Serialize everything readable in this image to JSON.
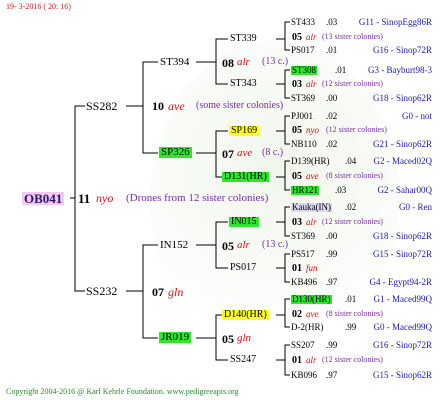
{
  "header": {
    "date": "19- 3-2016 ( 20: 16)"
  },
  "footer": {
    "copyright": "Copyright 2004-2016 @ Karl Kehrle Foundation.   www.pedigreeapis.org"
  },
  "root": {
    "id": "OB041",
    "year": "11",
    "race": "nyo",
    "note": "(Drones from 12 sister colonies)"
  },
  "gen1": [
    {
      "id": "SS282",
      "year": "10",
      "race": "ave",
      "note": "(some sister colonies)"
    },
    {
      "id": "SS232",
      "year": "07",
      "race": "gln",
      "note": ""
    }
  ],
  "gen2": [
    {
      "id": "ST394",
      "year": "08",
      "race": "alr",
      "note": "(13 c.)"
    },
    {
      "id": "SP326",
      "year": "07",
      "race": "ave",
      "note": "(8 c.)"
    },
    {
      "id": "IN152",
      "year": "05",
      "race": "alr",
      "note": "(13 c.)"
    },
    {
      "id": "JR019",
      "year": "05",
      "race": "gln",
      "note": ""
    }
  ],
  "gen3": [
    {
      "id": "ST339",
      "year": "05",
      "race": "alr",
      "note": "(13 sister colonies)"
    },
    {
      "id": "ST343",
      "year": "03",
      "race": "alr",
      "note": "(12 sister colonies)"
    },
    {
      "id": "SP169",
      "year": "05",
      "race": "nyo",
      "note": "(12 sister colonies)"
    },
    {
      "id": "D131(HR)",
      "year": "05",
      "race": "ave",
      "note": "(8 sister colonies)"
    },
    {
      "id": "IN015",
      "year": "03",
      "race": "alr",
      "note": "(12 sister colonies)"
    },
    {
      "id": "PS017",
      "year": "01",
      "race": "fun",
      "note": ""
    },
    {
      "id": "D140(HR)",
      "year": "02",
      "race": "ave",
      "note": "(8 sister colonies)"
    },
    {
      "id": "SS247",
      "year": "01",
      "race": "alr",
      "note": "(12 sister colonies)"
    }
  ],
  "gen4": [
    {
      "id": "ST433",
      "year": ".03",
      "group": "G11 - SinopEgg86R"
    },
    {
      "id": "PS017",
      "year": ".01",
      "group": "G16 - Sinop72R"
    },
    {
      "id": "ST308",
      "year": ".01",
      "group": "G3 - Bayburt98-3"
    },
    {
      "id": "ST369",
      "year": ".00",
      "group": "G18 - Sinop62R"
    },
    {
      "id": "PJ001",
      "year": ".02",
      "group": "G0 - not"
    },
    {
      "id": "NB110",
      "year": ".02",
      "group": "G21 - Sinop62R"
    },
    {
      "id": "D139(HR)",
      "year": ".04",
      "group": "G2 - Maced02Q"
    },
    {
      "id": "HR121",
      "year": ".03",
      "group": "G2 - Sahar00Q"
    },
    {
      "id": "Kauka(IN)",
      "year": ".02",
      "group": "G0 - Ren"
    },
    {
      "id": "ST369",
      "year": ".00",
      "group": "G18 - Sinop62R"
    },
    {
      "id": "PS517",
      "year": ".99",
      "group": "G15 - Sinop72R"
    },
    {
      "id": "KB496",
      "year": ".97",
      "group": "G4 - Egypt94-2R"
    },
    {
      "id": "D130(HR)",
      "year": ".01",
      "group": "G1 - Maced99Q"
    },
    {
      "id": "D-2(HR)",
      "year": ".99",
      "group": "G0 - Maced99Q"
    },
    {
      "id": "SS207",
      "year": ".99",
      "group": "G16 - Sinop72R"
    },
    {
      "id": "KB096",
      "year": ".97",
      "group": "G15 - Sinop62R"
    }
  ],
  "colors": {
    "green": "#2ee62e",
    "yellow": "#ffff22",
    "pink": "#f5c8f5",
    "lines": "#000000",
    "footer": "#2a8a2a",
    "header": "#cc2222"
  }
}
